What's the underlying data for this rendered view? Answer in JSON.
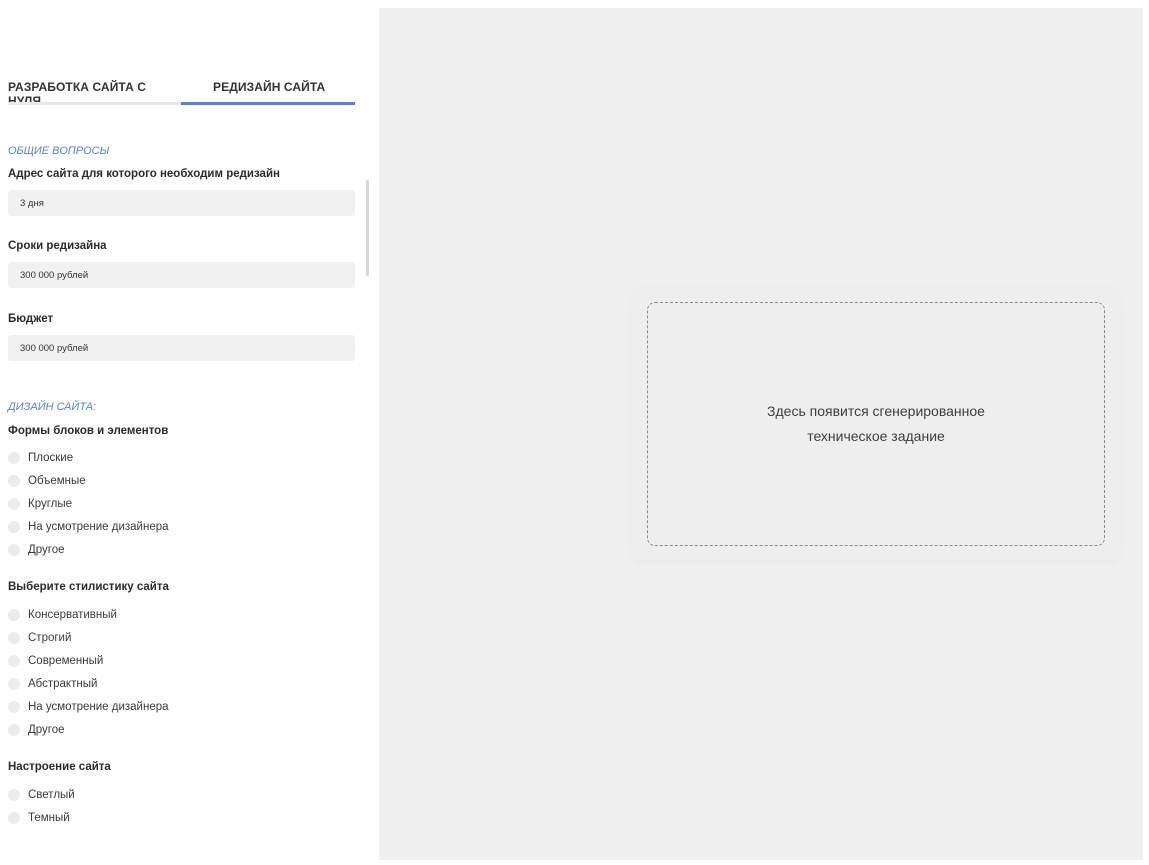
{
  "tabs": [
    {
      "label": "РАЗРАБОТКА САЙТА С НУЛЯ",
      "active": false
    },
    {
      "label": "РЕДИЗАЙН САЙТА",
      "active": true
    }
  ],
  "general": {
    "title": "ОБЩИЕ ВОПРОСЫ",
    "fields": [
      {
        "label": "Адрес сайта для которого необходим редизайн",
        "value": "3 дня"
      },
      {
        "label": "Сроки редизайна",
        "value": "300 000 рублей"
      },
      {
        "label": "Бюджет",
        "value": "300 000 рублей"
      }
    ]
  },
  "design": {
    "title": "ДИЗАЙН САЙТА:",
    "groups": [
      {
        "label": "Формы блоков и элементов",
        "options": [
          "Плоские",
          "Объемные",
          "Круглые",
          "На усмотрение дизайнера",
          "Другое"
        ]
      },
      {
        "label": "Выберите стилистику сайта",
        "options": [
          "Консервативный",
          "Строгий",
          "Современный",
          "Абстрактный",
          "На усмотрение дизайнера",
          "Другое"
        ]
      },
      {
        "label": "Настроение сайта",
        "options": [
          "Светлый",
          "Темный"
        ]
      }
    ]
  },
  "output": {
    "line1": "Здесь появится сгенерированное",
    "line2": "техническое задание"
  },
  "colors": {
    "accent": "#5b7fd6",
    "section_title": "#5b82d9",
    "panel_bg": "#f0f0f0",
    "input_bg": "#f1f1f1"
  }
}
